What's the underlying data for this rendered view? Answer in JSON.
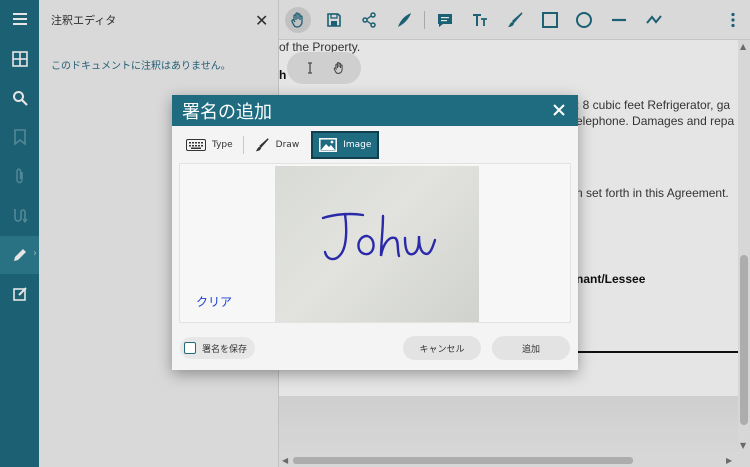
{
  "panel": {
    "title": "注釈エディタ",
    "empty_message": "このドキュメントに注釈はありません。"
  },
  "document": {
    "line1": "of the Property.",
    "line2": "h",
    "line3": ": 8 cubic feet Refrigerator, ga",
    "line4": "elephone. Damages and repa",
    "line5": "n set forth in this Agreement.",
    "line6": "nant/Lessee"
  },
  "dialog": {
    "title": "署名の追加",
    "tabs": [
      {
        "label": "Type",
        "icon": "keyboard-icon"
      },
      {
        "label": "Draw",
        "icon": "brush-icon"
      },
      {
        "label": "Image",
        "icon": "image-icon"
      }
    ],
    "active_tab": "Image",
    "signature_text": "John",
    "clear_label": "クリア",
    "save_signature_label": "署名を保存",
    "cancel_label": "キャンセル",
    "add_label": "追加"
  },
  "colors": {
    "accent": "#1f6b80",
    "link": "#1a3fd6",
    "ink": "#2a2aa8"
  }
}
